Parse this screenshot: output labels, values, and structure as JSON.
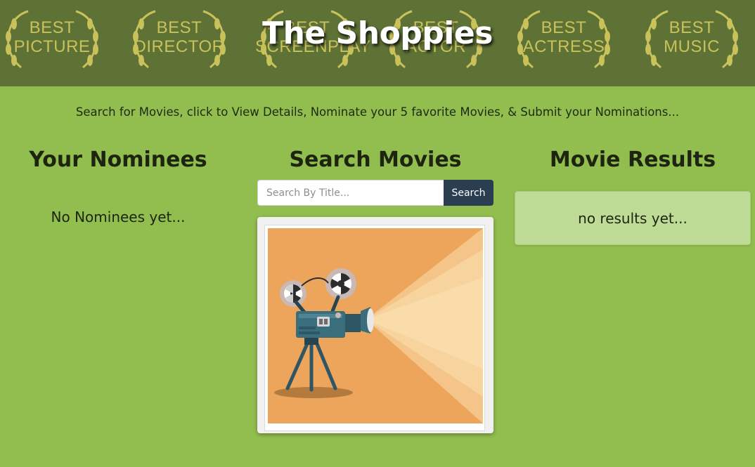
{
  "header": {
    "title": "The Shoppies",
    "background_color": "#5e7236",
    "awards": [
      {
        "lines": [
          "BEST",
          "PICTURE"
        ]
      },
      {
        "lines": [
          "BEST",
          "DIRECTOR"
        ]
      },
      {
        "lines": [
          "BEST",
          "SCREENPLAY"
        ]
      },
      {
        "lines": [
          "BEST",
          "ACTOR"
        ]
      },
      {
        "lines": [
          "BEST",
          "ACTRESS"
        ]
      },
      {
        "lines": [
          "BEST",
          "MUSIC"
        ]
      }
    ],
    "award_color": "#c9c15a"
  },
  "instructions": "Search for Movies, click to View Details, Nominate your 5 favorite Movies, & Submit your Nominations...",
  "nominees": {
    "heading": "Your Nominees",
    "empty_text": "No Nominees yet..."
  },
  "search": {
    "heading": "Search Movies",
    "placeholder": "Search By Title...",
    "value": "",
    "button_label": "Search",
    "button_color": "#2b3d51"
  },
  "poster": {
    "icon": "film-projector-illustration",
    "background_color": "#eca55b"
  },
  "results": {
    "heading": "Movie Results",
    "empty_text": "no results yet..."
  },
  "colors": {
    "page_background": "#92be4f",
    "results_box": "#bfdc96"
  }
}
